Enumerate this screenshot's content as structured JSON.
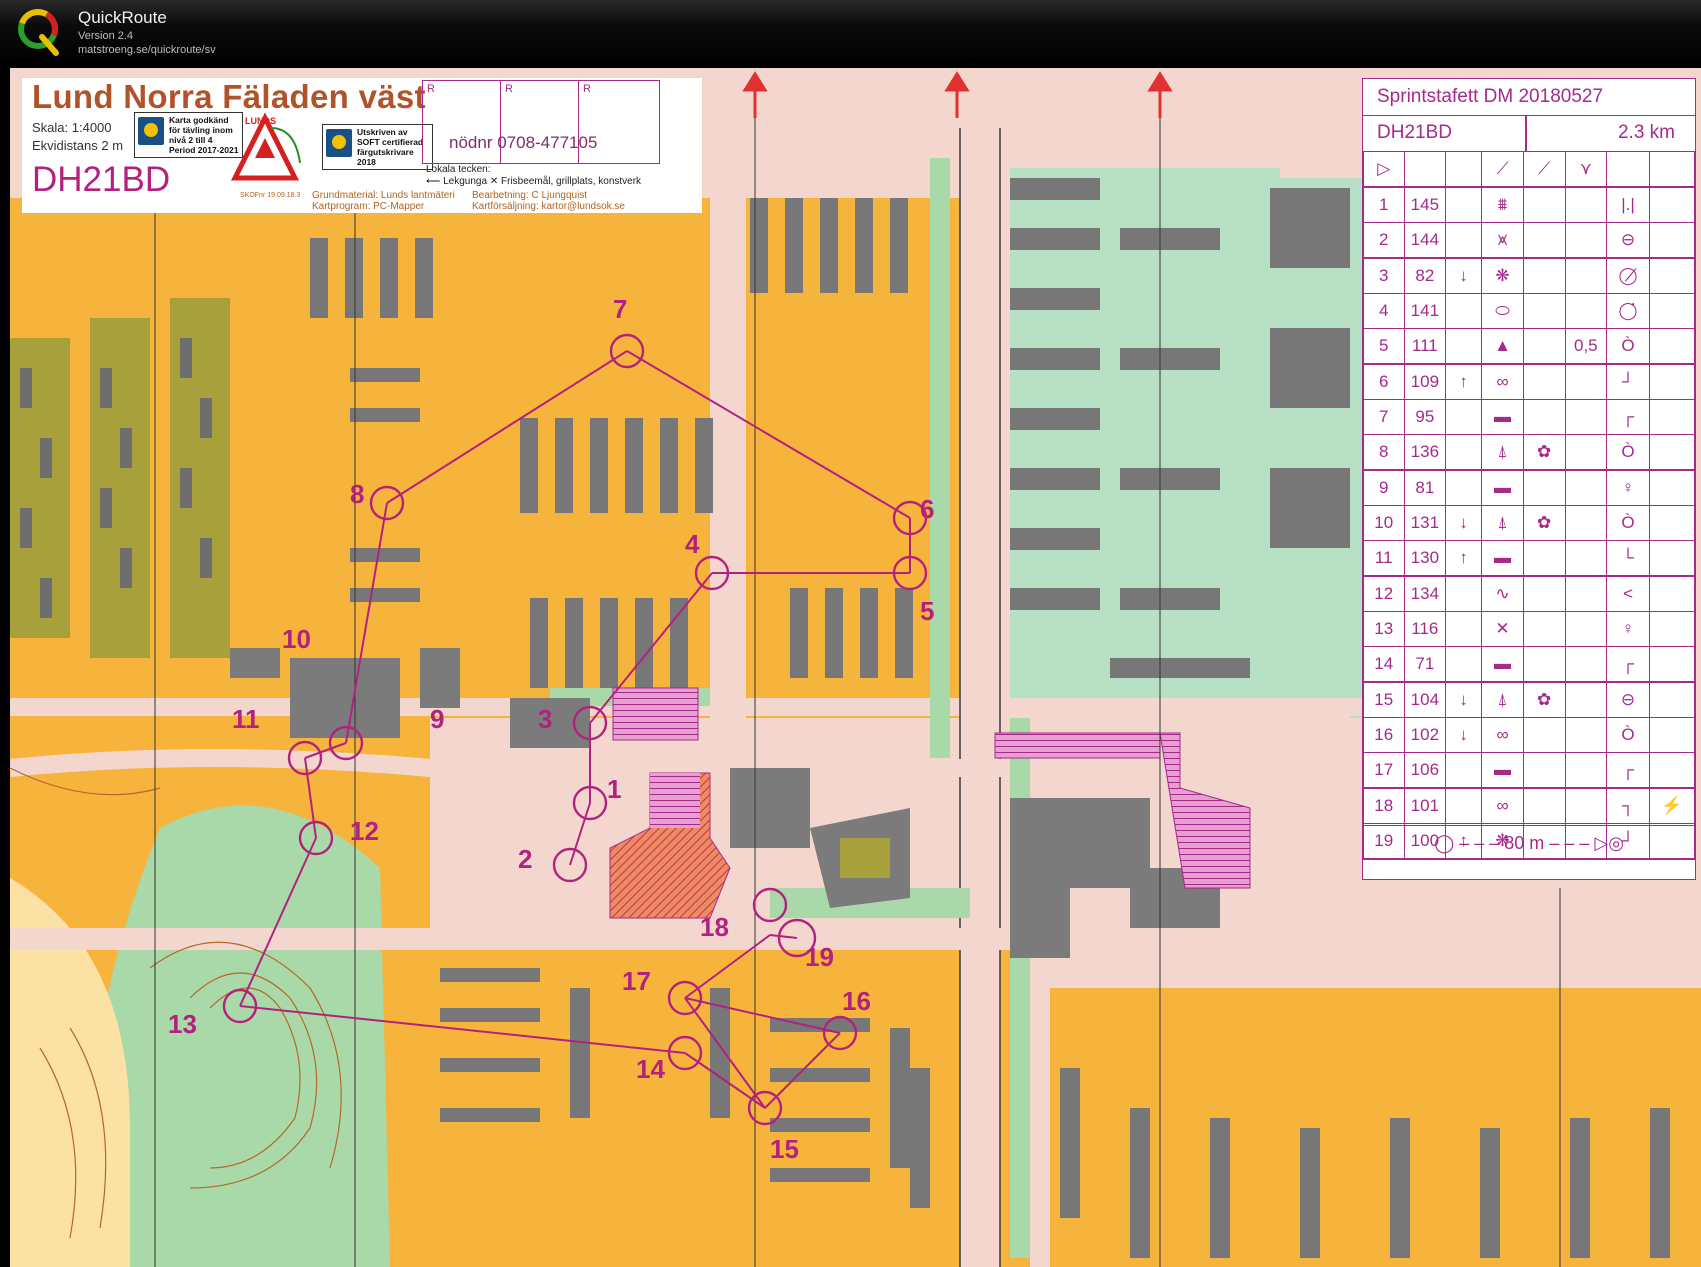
{
  "app": {
    "name": "QuickRoute",
    "version": "Version 2.4",
    "url": "matstroeng.se/quickroute/sv"
  },
  "map": {
    "title": "Lund Norra Fäladen väst",
    "scale": "Skala: 1:4000",
    "contour": "Ekvidistans 2 m",
    "class": "DH21BD",
    "badge_left": [
      "Karta godkänd",
      "för tävling inom",
      "nivå 2 till 4",
      "Period 2017-2021"
    ],
    "badge_right": [
      "Utskriven av",
      "SOFT certifierad",
      "färgutskrivare",
      "2018"
    ],
    "club_logo": "LUNDS OK",
    "sko_version": "SKOFnr 19.09.18.3",
    "r_labels": [
      "R",
      "R",
      "R"
    ],
    "phone": "nödnr 0708-477105",
    "local_symbols_title": "Lokala tecken:",
    "local_symbol_1": "Lekgunga",
    "local_symbol_2": "Frisbeemål, grillplats, konstverk",
    "credits": [
      "Grundmaterial: Lunds lantmäteri",
      "Kartprogram: PC-Mapper"
    ],
    "credits2": [
      "Bearbetning: C Ljungquist",
      "Kartförsäljning: kartor@lundsok.se"
    ],
    "colors": {
      "open": "#f7b43c",
      "rough": "#fbe1a4",
      "paved": "#f3d7ce",
      "building": "#7d7d7d",
      "green": "#a9d9a9",
      "course": "#b3217f",
      "contour": "#b5682a",
      "olive": "#a8a03a"
    }
  },
  "controls": [
    {
      "label": "1",
      "code": "145"
    },
    {
      "label": "2",
      "code": "144"
    },
    {
      "label": "3",
      "code": "82"
    },
    {
      "label": "4",
      "code": "141"
    },
    {
      "label": "5",
      "code": "111"
    },
    {
      "label": "6",
      "code": "109"
    },
    {
      "label": "7",
      "code": "95"
    },
    {
      "label": "8",
      "code": "136"
    },
    {
      "label": "9",
      "code": "81"
    },
    {
      "label": "10",
      "code": "131"
    },
    {
      "label": "11",
      "code": "130"
    },
    {
      "label": "12",
      "code": "134"
    },
    {
      "label": "13",
      "code": "116"
    },
    {
      "label": "14",
      "code": "71"
    },
    {
      "label": "15",
      "code": "104"
    },
    {
      "label": "16",
      "code": "102"
    },
    {
      "label": "17",
      "code": "106"
    },
    {
      "label": "18",
      "code": "101"
    },
    {
      "label": "19",
      "code": "100"
    }
  ],
  "description_sheet": {
    "event": "Sprintstafett DM 20180527",
    "class": "DH21BD",
    "length": "2.3 km",
    "rows": [
      {
        "n": "1",
        "code": "145",
        "dir": "",
        "feature": "⩩",
        "appear": "",
        "dim": "",
        "loc": "|.|"
      },
      {
        "n": "2",
        "code": "144",
        "dir": "",
        "feature": "⩙",
        "appear": "",
        "dim": "",
        "loc": "⊖"
      },
      {
        "n": "3",
        "code": "82",
        "dir": "↓",
        "feature": "❋",
        "appear": "",
        "dim": "",
        "loc": "◯̸"
      },
      {
        "n": "4",
        "code": "141",
        "dir": "",
        "feature": "⬭",
        "appear": "",
        "dim": "",
        "loc": "◯̇"
      },
      {
        "n": "5",
        "code": "111",
        "dir": "",
        "feature": "▲",
        "appear": "",
        "dim": "0,5",
        "loc": "Ò"
      },
      {
        "n": "6",
        "code": "109",
        "dir": "↑",
        "feature": "∞",
        "appear": "",
        "dim": "",
        "loc": "┘"
      },
      {
        "n": "7",
        "code": "95",
        "dir": "",
        "feature": "▬",
        "appear": "",
        "dim": "",
        "loc": "┌"
      },
      {
        "n": "8",
        "code": "136",
        "dir": "",
        "feature": "⍋",
        "appear": "✿",
        "dim": "",
        "loc": "Ò"
      },
      {
        "n": "9",
        "code": "81",
        "dir": "",
        "feature": "▬",
        "appear": "",
        "dim": "",
        "loc": "♀"
      },
      {
        "n": "10",
        "code": "131",
        "dir": "↓",
        "feature": "⍋",
        "appear": "✿",
        "dim": "",
        "loc": "Ò"
      },
      {
        "n": "11",
        "code": "130",
        "dir": "↑",
        "feature": "▬",
        "appear": "",
        "dim": "",
        "loc": "└"
      },
      {
        "n": "12",
        "code": "134",
        "dir": "",
        "feature": "∿",
        "appear": "",
        "dim": "",
        "loc": "<"
      },
      {
        "n": "13",
        "code": "116",
        "dir": "",
        "feature": "✕",
        "appear": "",
        "dim": "",
        "loc": "♀"
      },
      {
        "n": "14",
        "code": "71",
        "dir": "",
        "feature": "▬",
        "appear": "",
        "dim": "",
        "loc": "┌"
      },
      {
        "n": "15",
        "code": "104",
        "dir": "↓",
        "feature": "⍋",
        "appear": "✿",
        "dim": "",
        "loc": "⊖"
      },
      {
        "n": "16",
        "code": "102",
        "dir": "↓",
        "feature": "∞",
        "appear": "",
        "dim": "",
        "loc": "Ò"
      },
      {
        "n": "17",
        "code": "106",
        "dir": "",
        "feature": "▬",
        "appear": "",
        "dim": "",
        "loc": "┌"
      },
      {
        "n": "18",
        "code": "101",
        "dir": "",
        "feature": "∞",
        "appear": "",
        "dim": "",
        "loc": "┐",
        "extra": "⚡"
      },
      {
        "n": "19",
        "code": "100",
        "dir": "↑",
        "feature": "❋",
        "appear": "",
        "dim": "",
        "loc": "┘"
      }
    ],
    "footer": "80 m"
  }
}
